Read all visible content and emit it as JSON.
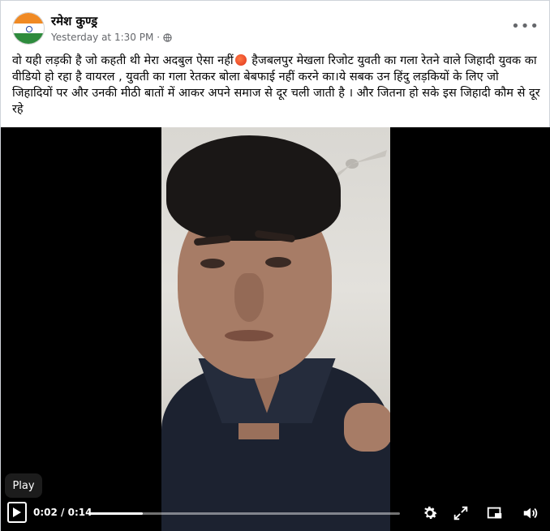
{
  "post": {
    "author": "रमेश कुण्ड्र",
    "timestamp": "Yesterday at 1:30 PM",
    "separator": "·",
    "privacy_icon": "globe-icon",
    "more_icon": "more-options-icon",
    "text_part1": "वो यही लड़की है जो कहती थी मेरा अदबुल ऐसा नहीं",
    "text_part2": " हैजबलपुर मेखला रिजोट युवती का गला रेतने वाले जिहादी युवक का वीडियो हो रहा है वायरल , युवती का गला रेतकर बोला बेबफाई नहीं करने का।ये सबक उन हिंदु लड़कियों के लिए जो जिहादियों पर और उनकी मीठी बातों में आकर अपने समाज से दूर चली जाती है । और जितना हो सके इस जिहादी कौम से दूर रहे",
    "emoji_icon": "angry-face-emoji"
  },
  "video": {
    "tooltip": "Play",
    "current_time": "0:02",
    "duration": "0:14",
    "time_separator": " / ",
    "progress_fraction": 0.175,
    "icons": [
      "play-icon",
      "settings-gear-icon",
      "fullscreen-expand-icon",
      "picture-in-picture-icon",
      "volume-icon"
    ]
  },
  "colors": {
    "text_primary": "#050505",
    "text_secondary": "#65676b",
    "video_bg": "#000000",
    "controls_fg": "#ffffff"
  }
}
